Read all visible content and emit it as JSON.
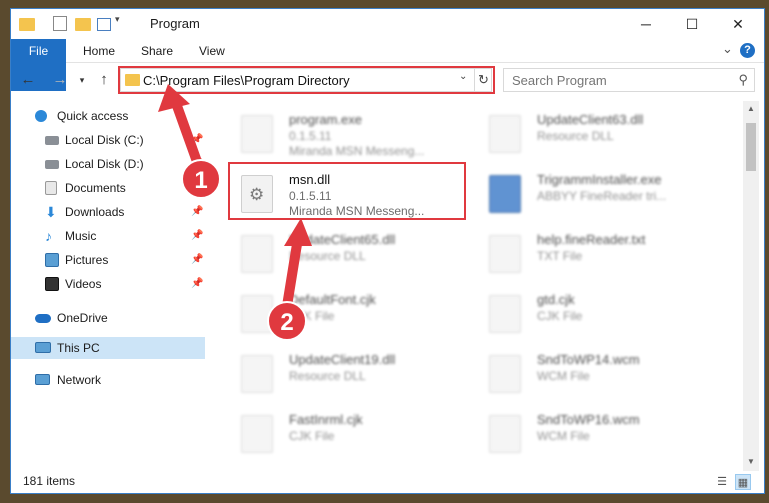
{
  "window": {
    "title": "Program",
    "controls": {
      "minimize": "─",
      "maximize": "☐",
      "close": "✕"
    }
  },
  "ribbon": {
    "tabs": [
      "File",
      "Home",
      "Share",
      "View"
    ],
    "help_icon": "?",
    "expand_icon": "⌄"
  },
  "address": {
    "path": "C:\\Program Files\\Program Directory",
    "refresh_icon": "↻"
  },
  "search": {
    "placeholder": "Search Program"
  },
  "nav": {
    "items": [
      {
        "label": "Quick access",
        "icon": "star-icon",
        "pinned": false
      },
      {
        "label": "Local Disk (C:)",
        "icon": "drive-icon",
        "pinned": true
      },
      {
        "label": "Local Disk (D:)",
        "icon": "drive-icon",
        "pinned": true
      },
      {
        "label": "Documents",
        "icon": "documents-icon",
        "pinned": true
      },
      {
        "label": "Downloads",
        "icon": "download-icon",
        "pinned": true
      },
      {
        "label": "Music",
        "icon": "music-icon",
        "pinned": true
      },
      {
        "label": "Pictures",
        "icon": "pictures-icon",
        "pinned": true
      },
      {
        "label": "Videos",
        "icon": "videos-icon",
        "pinned": true
      },
      {
        "label": "OneDrive",
        "icon": "cloud-icon",
        "pinned": false
      },
      {
        "label": "This PC",
        "icon": "computer-icon",
        "pinned": false
      },
      {
        "label": "Network",
        "icon": "network-icon",
        "pinned": false
      }
    ]
  },
  "files": {
    "left": [
      {
        "name": "program.exe",
        "line2": "0.1.5.11",
        "line3": "Miranda MSN Messeng..."
      },
      {
        "name": "msn.dll",
        "line2": "0.1.5.11",
        "line3": "Miranda MSN Messeng..."
      },
      {
        "name": "UpdateClient65.dll",
        "line2": "Resource DLL",
        "line3": ""
      },
      {
        "name": "DefaultFont.cjk",
        "line2": "CJK File",
        "line3": ""
      },
      {
        "name": "UpdateClient19.dll",
        "line2": "Resource DLL",
        "line3": ""
      },
      {
        "name": "FastInrml.cjk",
        "line2": "CJK File",
        "line3": ""
      }
    ],
    "right": [
      {
        "name": "UpdateClient63.dll",
        "line2": "Resource DLL",
        "line3": ""
      },
      {
        "name": "TrigrammInstaller.exe",
        "line2": "ABBYY FineReader tri...",
        "line3": ""
      },
      {
        "name": "help.fineReader.txt",
        "line2": "TXT File",
        "line3": ""
      },
      {
        "name": "gtd.cjk",
        "line2": "CJK File",
        "line3": ""
      },
      {
        "name": "SndToWP14.wcm",
        "line2": "WCM File",
        "line3": ""
      },
      {
        "name": "SndToWP16.wcm",
        "line2": "WCM File",
        "line3": ""
      }
    ]
  },
  "status": {
    "item_count": "181 items"
  },
  "annotations": {
    "badge1": "1",
    "badge2": "2",
    "color": "#e0393f"
  }
}
